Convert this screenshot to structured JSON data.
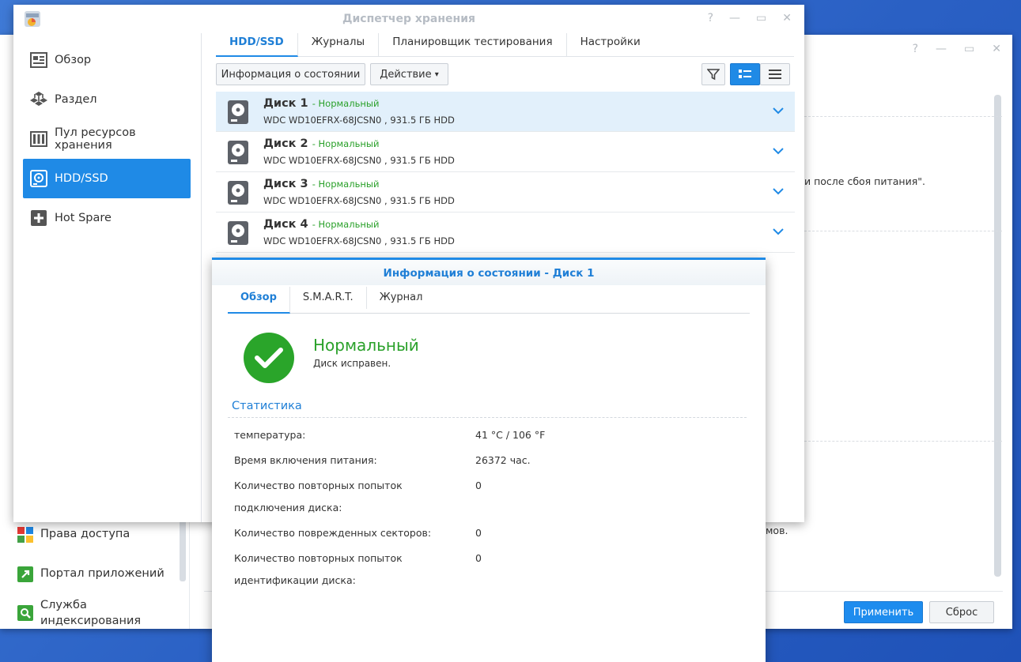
{
  "back_window": {
    "sidebar_items": [
      {
        "label": "Права доступа",
        "icon": "access-rights-icon"
      },
      {
        "label": "Портал приложений",
        "icon": "app-portal-icon"
      },
      {
        "label": "Служба индексирования",
        "icon": "indexing-service-icon"
      }
    ],
    "partial_text_1": "и после сбоя питания\".",
    "partial_text_2": "мов.",
    "apply_label": "Применить",
    "reset_label": "Сброс"
  },
  "window": {
    "title": "Диспетчер хранения",
    "help_glyph": "?",
    "minimize_glyph": "—",
    "maximize_glyph": "▭",
    "close_glyph": "✕"
  },
  "sidebar": {
    "items": [
      {
        "label": "Обзор",
        "icon": "overview-icon"
      },
      {
        "label": "Раздел",
        "icon": "volume-icon"
      },
      {
        "label": "Пул ресурсов хранения",
        "icon": "storage-pool-icon"
      },
      {
        "label": "HDD/SSD",
        "icon": "hdd-icon",
        "active": true
      },
      {
        "label": "Hot Spare",
        "icon": "hot-spare-icon"
      }
    ]
  },
  "tabs": [
    {
      "label": "HDD/SSD",
      "active": true
    },
    {
      "label": "Журналы"
    },
    {
      "label": "Планировщик тестирования"
    },
    {
      "label": "Настройки"
    }
  ],
  "toolbar": {
    "health_info_label": "Информация о состоянии",
    "action_label": "Действие",
    "action_caret": "▾"
  },
  "disks": [
    {
      "name": "Диск 1",
      "status": "- Нормальный",
      "model": "WDC WD10EFRX-68JCSN0 , 931.5 ГБ HDD"
    },
    {
      "name": "Диск 2",
      "status": "- Нормальный",
      "model": "WDC WD10EFRX-68JCSN0 , 931.5 ГБ HDD"
    },
    {
      "name": "Диск 3",
      "status": "- Нормальный",
      "model": "WDC WD10EFRX-68JCSN0 , 931.5 ГБ HDD"
    },
    {
      "name": "Диск 4",
      "status": "- Нормальный",
      "model": "WDC WD10EFRX-68JCSN0 , 931.5 ГБ HDD"
    }
  ],
  "dialog": {
    "title": "Информация о состоянии - Диск 1",
    "tabs": [
      {
        "label": "Обзор",
        "active": true
      },
      {
        "label": "S.M.A.R.T."
      },
      {
        "label": "Журнал"
      }
    ],
    "status_title": "Нормальный",
    "status_desc": "Диск исправен.",
    "stats_title": "Статистика",
    "stats": [
      {
        "label": "температура:",
        "value": "41 °C / 106 °F"
      },
      {
        "label": "Время включения питания:",
        "value": "26372 час."
      },
      {
        "label": "Количество повторных попыток подключения диска:",
        "value": "0"
      },
      {
        "label": "Количество поврежденных секторов:",
        "value": "0"
      },
      {
        "label": "Количество повторных попыток идентификации диска:",
        "value": "0"
      }
    ]
  },
  "colors": {
    "accent": "#1f8ae6",
    "status_ok": "#2aa12a",
    "selected_row": "#e2f0fb"
  }
}
